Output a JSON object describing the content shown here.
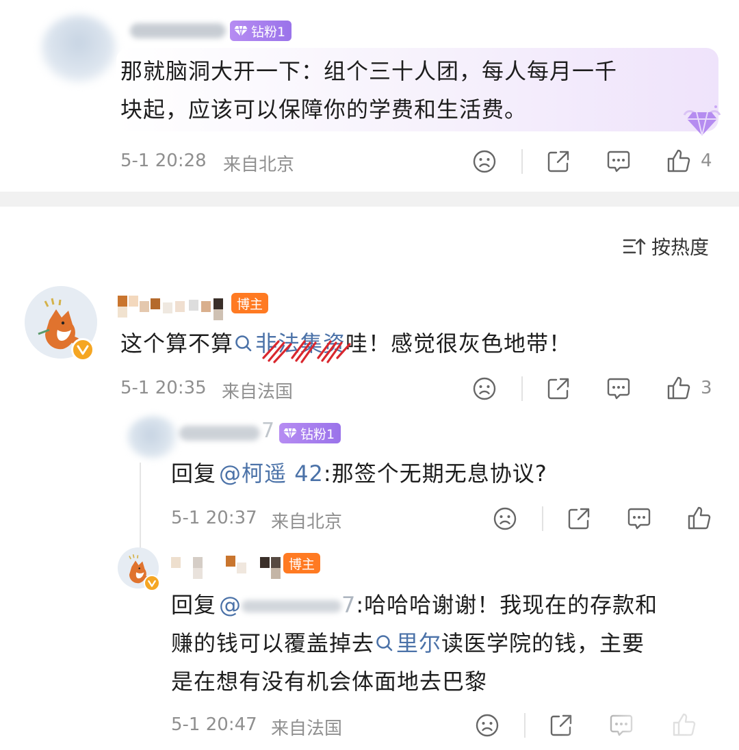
{
  "comments": [
    {
      "badge": "钻粉1",
      "text_line1": "那就脑洞大开一下：组个三十人团，每人每月一千",
      "text_line2": "块起，应该可以保障你的学费和生活费。",
      "time": "5-1 20:28",
      "location": "来自北京",
      "likes": "4"
    },
    {
      "badge": "博主",
      "text_pre": "这个算不算",
      "text_topic": "非法集资",
      "text_post": "哇！感觉很灰色地带！",
      "time": "5-1 20:35",
      "location": "来自法国",
      "likes": "3"
    },
    {
      "badge": "钻粉1",
      "text_reply_prefix": "回复",
      "text_mention": "@柯遥 42",
      "text_post": ":那签个无期无息协议?",
      "time": "5-1 20:37",
      "location": "来自北京",
      "likes": ""
    },
    {
      "badge": "博主",
      "text_reply_prefix": "回复",
      "text_mention": "@",
      "text_mention_tail": "7",
      "text_line1_post": ":哈哈哈谢谢！我现在的存款和",
      "text_line2_pre": "赚的钱可以覆盖掉去",
      "text_topic": "里尔",
      "text_line2_post": "读医学院的钱，主要",
      "text_line3": "是在想有没有机会体面地去巴黎",
      "time": "5-1 20:47",
      "location": "来自法国"
    }
  ],
  "sort": {
    "label": "按热度"
  },
  "icons": {
    "dislike": "sad-face-icon",
    "share": "share-icon",
    "comment": "comment-icon",
    "like": "thumbs-up-icon",
    "topic": "search-icon",
    "verified": "verified-v-icon",
    "sort": "sort-icon"
  },
  "colors": {
    "link": "#4b72a8",
    "host_badge": "#ff7a22",
    "fan_badge": "#a47eef",
    "verified": "#f5a623"
  }
}
